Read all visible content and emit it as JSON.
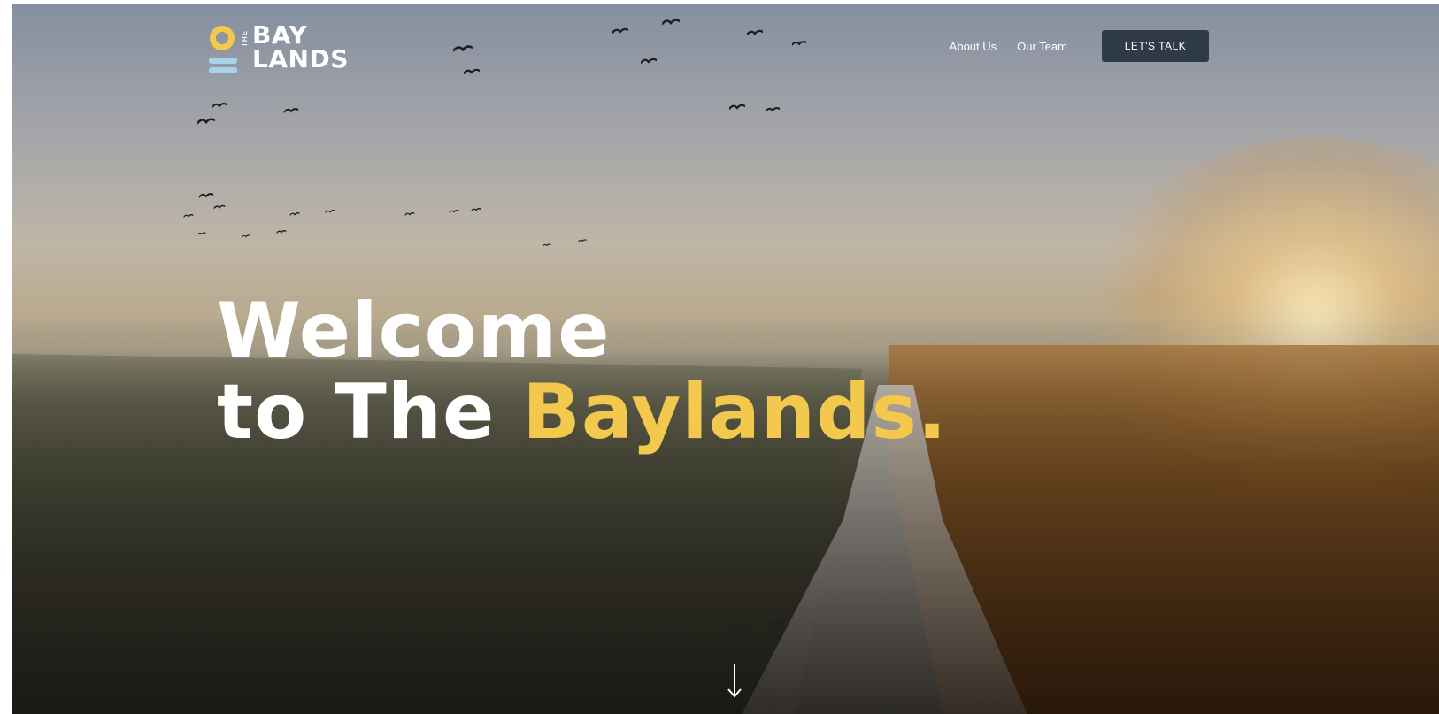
{
  "brand": {
    "logo_the": "THE",
    "logo_line1": "BAY",
    "logo_line2": "LANDS",
    "accent_color": "#f2c94c",
    "wave_color": "#a9d3e6"
  },
  "nav": {
    "links": [
      {
        "label": "About Us"
      },
      {
        "label": "Our Team"
      }
    ],
    "cta_label": "LET'S TALK",
    "cta_color": "#2f3a47"
  },
  "hero": {
    "headline_line1": "Welcome",
    "headline_line2_prefix": "to The ",
    "headline_line2_accent": "Baylands.",
    "scroll_icon": "arrow-down-icon",
    "background_description_icon": "marsh-sunrise-photo"
  }
}
